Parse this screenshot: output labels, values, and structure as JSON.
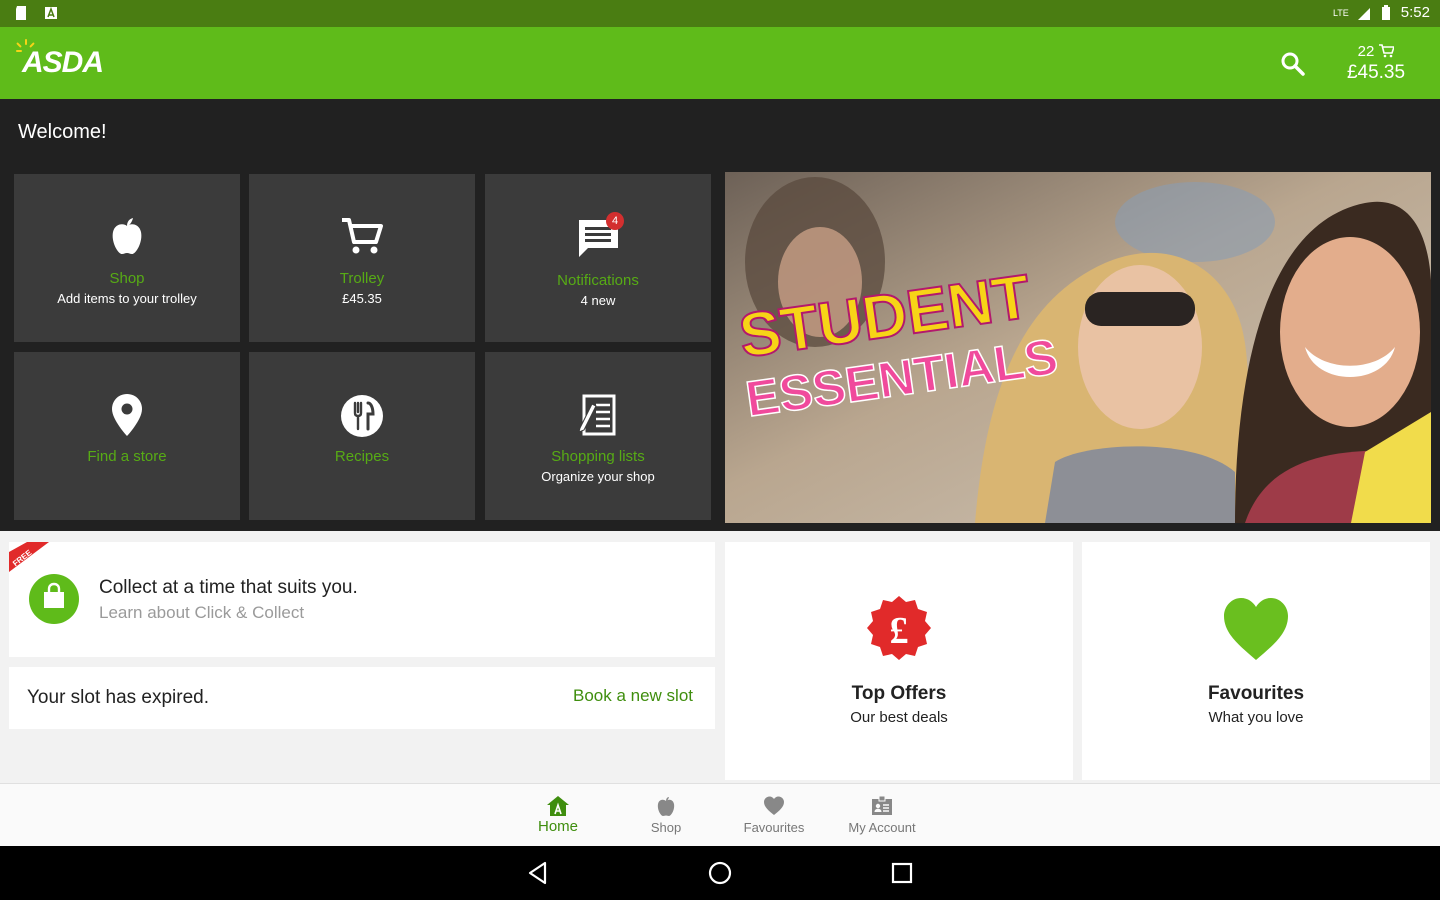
{
  "status_bar": {
    "time": "5:52",
    "network": "LTE"
  },
  "header": {
    "logo_text": "ASDA",
    "cart_count": "22",
    "cart_total": "£45.35"
  },
  "welcome": "Welcome!",
  "tiles": [
    {
      "title": "Shop",
      "subtitle": "Add items to your trolley",
      "icon": "apple-icon"
    },
    {
      "title": "Trolley",
      "subtitle": "£45.35",
      "icon": "cart-icon"
    },
    {
      "title": "Notifications",
      "subtitle": "4 new",
      "icon": "message-icon",
      "badge": "4"
    },
    {
      "title": "Find a store",
      "subtitle": "",
      "icon": "location-pin-icon"
    },
    {
      "title": "Recipes",
      "subtitle": "",
      "icon": "fork-knife-icon"
    },
    {
      "title": "Shopping lists",
      "subtitle": "Organize your shop",
      "icon": "list-icon"
    }
  ],
  "banner": {
    "line1": "STUDENT",
    "line2": "ESSENTIALS"
  },
  "collect": {
    "ribbon": "FREE",
    "title": "Collect at a time that suits you.",
    "subtitle": "Learn about Click & Collect"
  },
  "slot": {
    "text": "Your slot has expired.",
    "action": "Book a new slot"
  },
  "features": [
    {
      "title": "Top Offers",
      "subtitle": "Our best deals",
      "icon": "pound-badge-icon"
    },
    {
      "title": "Favourites",
      "subtitle": "What you love",
      "icon": "heart-icon"
    }
  ],
  "bottom_nav": [
    {
      "label": "Home",
      "icon": "home-icon",
      "active": true
    },
    {
      "label": "Shop",
      "icon": "apple-icon",
      "active": false
    },
    {
      "label": "Favourites",
      "icon": "heart-icon",
      "active": false
    },
    {
      "label": "My Account",
      "icon": "account-icon",
      "active": false
    }
  ],
  "colors": {
    "brand_green": "#5fbb1a",
    "status_green": "#4a7d12",
    "tile_bg": "#3b3b3b",
    "tile_title": "#57ab15",
    "offer_red": "#e12a2a",
    "link_green": "#3f8e0e"
  }
}
